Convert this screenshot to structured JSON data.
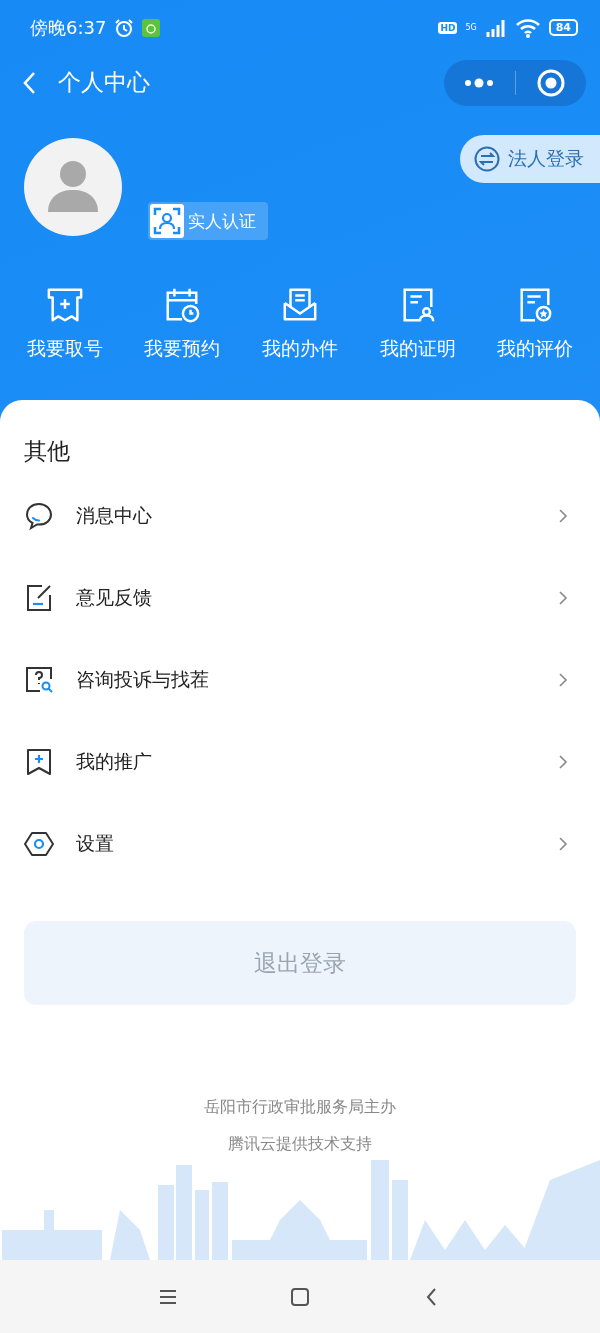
{
  "status_bar": {
    "time": "傍晚6:37",
    "hd": "HD",
    "network": "5G",
    "battery": "84"
  },
  "nav": {
    "title": "个人中心"
  },
  "profile": {
    "verify_label": "实人认证",
    "legal_login": "法人登录"
  },
  "quick_actions": [
    {
      "kind": "ticket",
      "label": "我要取号"
    },
    {
      "kind": "appointment",
      "label": "我要预约"
    },
    {
      "kind": "case",
      "label": "我的办件"
    },
    {
      "kind": "certificate",
      "label": "我的证明"
    },
    {
      "kind": "rating",
      "label": "我的评价"
    }
  ],
  "section_title": "其他",
  "menu": [
    {
      "kind": "message",
      "label": "消息中心"
    },
    {
      "kind": "feedback",
      "label": "意见反馈"
    },
    {
      "kind": "consult",
      "label": "咨询投诉与找茬"
    },
    {
      "kind": "promote",
      "label": "我的推广"
    },
    {
      "kind": "settings",
      "label": "设置"
    }
  ],
  "logout_button": "退出登录",
  "footer": [
    "岳阳市行政审批服务局主办",
    "腾讯云提供技术支持"
  ]
}
